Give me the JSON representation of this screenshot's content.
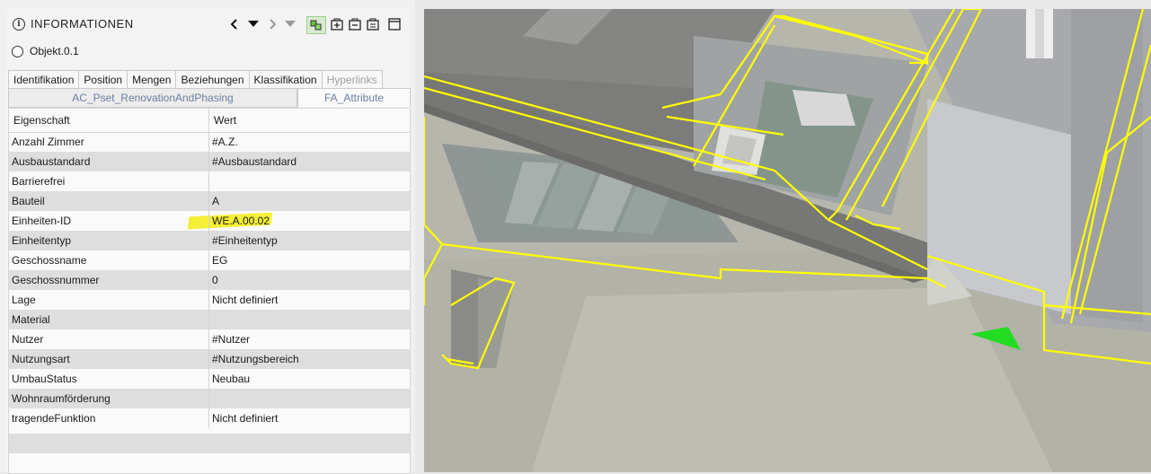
{
  "panel": {
    "title": "INFORMATIONEN",
    "object_label": "Objekt.0.1",
    "tabs_row1": [
      "Identifikation",
      "Position",
      "Mengen",
      "Beziehungen",
      "Klassifikation",
      "Hyperlinks"
    ],
    "tabs_row2": [
      "AC_Pset_RenovationAndPhasing",
      "FA_Attribute"
    ],
    "active_tab_row2": "FA_Attribute",
    "table": {
      "headers": [
        "Eigenschaft",
        "Wert"
      ],
      "rows": [
        {
          "property": "Anzahl Zimmer",
          "value": "#A.Z."
        },
        {
          "property": "Ausbaustandard",
          "value": "#Ausbaustandard"
        },
        {
          "property": "Barrierefrei",
          "value": ""
        },
        {
          "property": "Bauteil",
          "value": "A"
        },
        {
          "property": "Einheiten-ID",
          "value": "WE.A.00.02"
        },
        {
          "property": "Einheitentyp",
          "value": "#Einheitentyp"
        },
        {
          "property": "Geschossname",
          "value": "EG"
        },
        {
          "property": "Geschossnummer",
          "value": "0"
        },
        {
          "property": "Lage",
          "value": "Nicht definiert"
        },
        {
          "property": "Material",
          "value": ""
        },
        {
          "property": "Nutzer",
          "value": "#Nutzer"
        },
        {
          "property": "Nutzungsart",
          "value": "#Nutzungsbereich"
        },
        {
          "property": "UmbauStatus",
          "value": "Neubau"
        },
        {
          "property": "Wohnraumförderung",
          "value": ""
        },
        {
          "property": "tragendeFunktion",
          "value": "Nicht definiert"
        }
      ]
    }
  },
  "icons": {
    "info": "info-icon",
    "prev": "chevron-left-icon",
    "dropdown": "caret-down-icon",
    "next": "chevron-right-icon",
    "dropdown_disabled": "caret-down-icon",
    "objects": "objects-icon",
    "add_group": "add-group-icon",
    "remove_group": "remove-group-icon",
    "list": "list-icon",
    "window": "window-icon"
  },
  "colors": {
    "highlight": "#f4ee2a",
    "selection_outline": "#ffff00",
    "nav_arrow": "#22dd22",
    "tab_text": "#6b7fa0"
  }
}
